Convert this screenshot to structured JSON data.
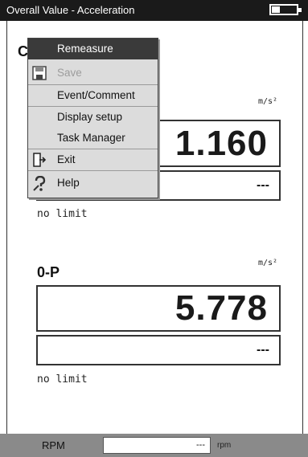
{
  "titlebar": {
    "title": "Overall Value - Acceleration",
    "battery_icon": "battery-icon"
  },
  "sections": [
    {
      "title": "C",
      "unit": "m/s²",
      "value": "1.160",
      "sub_value": "---",
      "limit": "no limit"
    },
    {
      "title": "0-P",
      "unit": "m/s²",
      "value": "5.778",
      "sub_value": "---",
      "limit": "no limit"
    }
  ],
  "menu": {
    "items": [
      {
        "label": "Remeasure",
        "state": "selected",
        "icon": ""
      },
      {
        "label": "Save",
        "state": "disabled",
        "icon": "save-icon"
      },
      {
        "label": "Event/Comment",
        "state": "enabled",
        "icon": ""
      },
      {
        "label": "Display setup",
        "state": "enabled",
        "icon": ""
      },
      {
        "label": "Task Manager",
        "state": "enabled",
        "icon": ""
      },
      {
        "label": "Exit",
        "state": "enabled",
        "icon": "exit-icon"
      },
      {
        "label": "Help",
        "state": "enabled",
        "icon": "help-icon"
      }
    ]
  },
  "bottombar": {
    "rpm_label": "RPM",
    "rpm_value": "---",
    "rpm_unit": "rpm"
  }
}
